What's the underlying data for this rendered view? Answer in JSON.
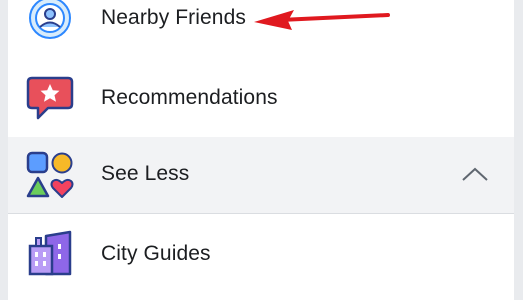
{
  "menu": {
    "items": [
      {
        "label": "Nearby Friends",
        "icon": "nearby-friends-icon"
      },
      {
        "label": "Recommendations",
        "icon": "recommendations-icon"
      },
      {
        "label": "See Less",
        "icon": "shapes-icon",
        "expanded": true
      },
      {
        "label": "City Guides",
        "icon": "city-guides-icon"
      }
    ]
  },
  "colors": {
    "annotation_arrow": "#e0191f",
    "recommendations_bubble": "#e8505b",
    "see_less_bg": "#f2f3f5"
  }
}
